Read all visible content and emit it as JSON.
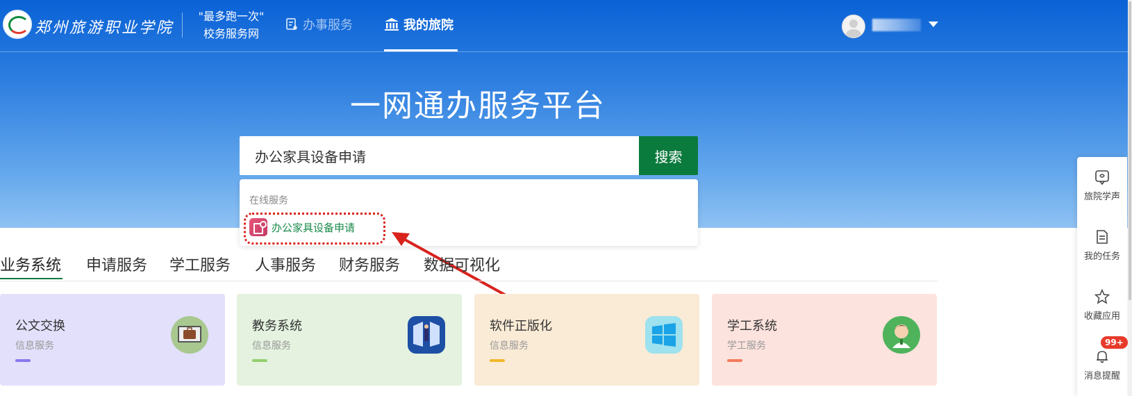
{
  "header": {
    "school_name": "郑州旅游职业学院",
    "slogan_line1": "\"最多跑一次\"",
    "slogan_line2": "校务服务网",
    "nav": [
      {
        "label": "办事服务",
        "icon": "document-icon"
      },
      {
        "label": "我的旅院",
        "icon": "institution-icon"
      }
    ]
  },
  "hero": {
    "title": "一网通办服务平台"
  },
  "search": {
    "value": "办公家具设备申请",
    "button_label": "搜索"
  },
  "dropdown": {
    "category": "在线服务",
    "result_label": "办公家具设备申请"
  },
  "tabs": [
    "业务系统",
    "申请服务",
    "学工服务",
    "人事服务",
    "财务服务",
    "数据可视化"
  ],
  "cards": [
    {
      "title": "公文交换",
      "subtitle": "信息服务",
      "bg": "#e3e0fb",
      "bar": "#8a76ee",
      "icon": "briefcase-icon",
      "icon_bg": "#a8c890"
    },
    {
      "title": "教务系统",
      "subtitle": "信息服务",
      "bg": "#e4f2df",
      "bar": "#95cf6b",
      "icon": "door-icon",
      "icon_bg": "#1d4fa5"
    },
    {
      "title": "软件正版化",
      "subtitle": "信息服务",
      "bg": "#faebd6",
      "bar": "#f3b72c",
      "icon": "windows-icon",
      "icon_bg": "#9ee1ef"
    },
    {
      "title": "学工系统",
      "subtitle": "学工服务",
      "bg": "#fde3dd",
      "bar": "#f47c5c",
      "icon": "student-icon",
      "icon_bg": "#4fb35b"
    }
  ],
  "side_panel": [
    {
      "label": "旅院学声",
      "icon": "feedback-icon"
    },
    {
      "label": "我的任务",
      "icon": "task-icon"
    },
    {
      "label": "收藏应用",
      "icon": "star-icon"
    },
    {
      "label": "消息提醒",
      "icon": "bell-icon",
      "badge": "99+"
    }
  ],
  "colors": {
    "primary_green": "#0b7a3d",
    "hero_blue": "#0a62d6",
    "annotation_red": "#d8231c"
  }
}
